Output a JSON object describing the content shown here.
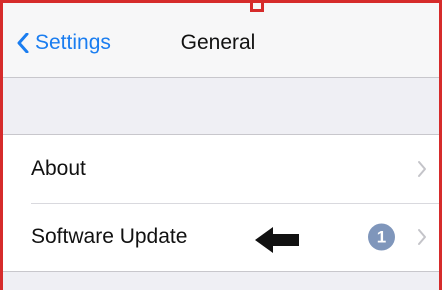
{
  "navbar": {
    "back_label": "Settings",
    "title": "General"
  },
  "rows": [
    {
      "label": "About",
      "chevron": "chevron-right-icon"
    },
    {
      "label": "Software Update",
      "badge": "1",
      "chevron": "chevron-right-icon"
    }
  ],
  "colors": {
    "accent": "#1a7df0",
    "badge": "#7f96bb",
    "frame_border": "#d62b2b",
    "background": "#efeff4"
  },
  "icons": {
    "back": "chevron-left-icon",
    "annotation_arrow": "left-arrow-icon"
  }
}
